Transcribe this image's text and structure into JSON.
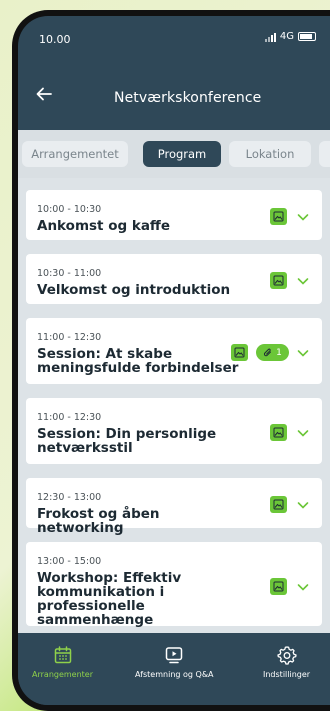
{
  "status_bar": {
    "time": "10.00",
    "network": "4G"
  },
  "app_bar": {
    "title": "Netværkskonference"
  },
  "tabs": [
    {
      "label": "Arrangementet",
      "active": false
    },
    {
      "label": "Program",
      "active": true
    },
    {
      "label": "Lokation",
      "active": false
    },
    {
      "label": "D",
      "active": false
    }
  ],
  "sessions": [
    {
      "time": "10:00 - 10:30",
      "title": "Ankomst og kaffe"
    },
    {
      "time": "10:30 - 11:00",
      "title": "Velkomst og introduktion"
    },
    {
      "time": "11:00 - 12:30",
      "title": "Session: At skabe meningsfulde forbindelser",
      "attachments": "1"
    },
    {
      "time": "11:00 - 12:30",
      "title": "Session: Din personlige netværksstil"
    },
    {
      "time": "12:30 - 13:00",
      "title": "Frokost og åben networking"
    },
    {
      "time": "13:00 - 15:00",
      "title": "Workshop: Effektiv kommunikation i professionelle sammenhænge"
    }
  ],
  "bottom_nav": [
    {
      "label": "Arrangementer",
      "icon": "calendar-icon",
      "active": true
    },
    {
      "label": "Afstemning og Q&A",
      "icon": "play-screen-icon",
      "active": false
    },
    {
      "label": "Indstillinger",
      "icon": "gear-icon",
      "active": false
    }
  ],
  "colors": {
    "primary": "#2f4858",
    "accent_green": "#6bc638",
    "nav_active": "#8fd14a",
    "list_bg": "#dde3e7",
    "tabs_bg": "#d9dfe3"
  }
}
